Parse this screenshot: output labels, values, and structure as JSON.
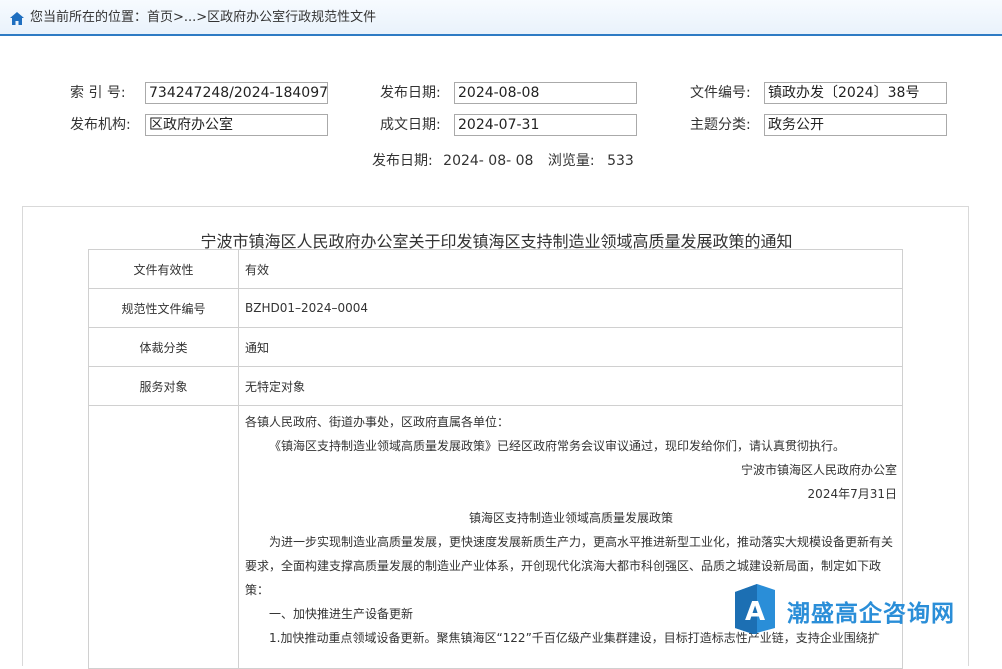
{
  "breadcrumb": {
    "text": "您当前所在的位置：首页>...>区政府办公室行政规范性文件"
  },
  "meta": {
    "index_label": "索 引 号:",
    "index_value": "734247248/2024-184097",
    "pubdate_label": "发布日期:",
    "pubdate_value": "2024-08-08",
    "docno_label": "文件编号:",
    "docno_value": "镇政办发〔2024〕38号",
    "org_label": "发布机构:",
    "org_value": "区政府办公室",
    "written_label": "成文日期:",
    "written_value": "2024-07-31",
    "topic_label": "主题分类:",
    "topic_value": "政务公开",
    "pub_line_label": "发布日期:",
    "pub_line_date": "2024- 08- 08",
    "views_label": "浏览量:",
    "views_value": "533"
  },
  "article": {
    "title": "宁波市镇海区人民政府办公室关于印发镇海区支持制造业领域高质量发展政策的通知",
    "rows": [
      {
        "key": "文件有效性",
        "value": "有效"
      },
      {
        "key": "规范性文件编号",
        "value": "BZHD01–2024–0004"
      },
      {
        "key": "体裁分类",
        "value": "通知"
      },
      {
        "key": "服务对象",
        "value": "无特定对象"
      }
    ],
    "body": {
      "greeting": "各镇人民政府、街道办事处，区政府直属各单位：",
      "intro": "《镇海区支持制造业领域高质量发展政策》已经区政府常务会议审议通过，现印发给你们，请认真贯彻执行。",
      "issuer": "宁波市镇海区人民政府办公室",
      "date": "2024年7月31日",
      "policy_title": "镇海区支持制造业领域高质量发展政策",
      "para1": "为进一步实现制造业高质量发展，更快速度发展新质生产力，更高水平推进新型工业化，推动落实大规模设备更新有关要求，全面构建支撑高质量发展的制造业产业体系，开创现代化滨海大都市科创强区、品质之城建设新局面，制定如下政策：",
      "section1": "一、加快推进生产设备更新",
      "item1": "1.加快推动重点领域设备更新。聚焦镇海区“122”千百亿级产业集群建设，目标打造标志性产业链，支持企业围绕扩"
    }
  },
  "watermark": {
    "text": "潮盛高企咨询网"
  },
  "colors": {
    "accent": "#2e7bc4",
    "watermark": "#2a8ed8"
  }
}
